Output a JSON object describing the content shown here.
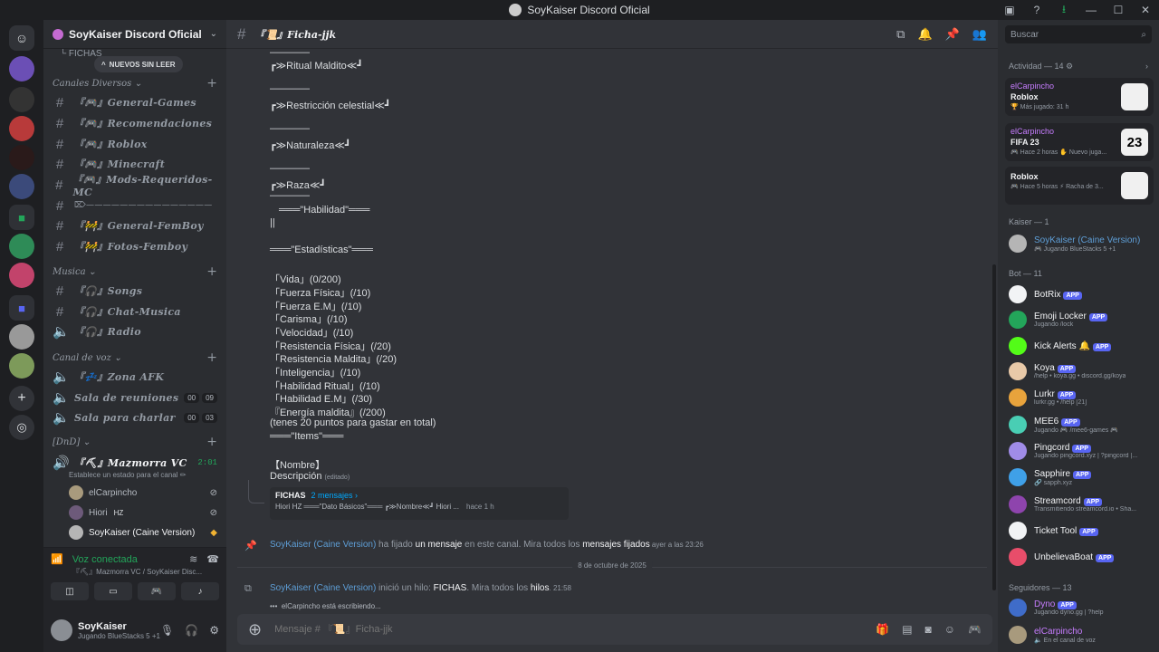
{
  "window": {
    "title": "SoyKaiser Discord Oficial"
  },
  "guild": {
    "name": "SoyKaiser Discord Oficial",
    "new_unread": "NUEVOS SIN LEER",
    "fichas_label": "FICHAS"
  },
  "categories": {
    "diversos": "Canales Diversos",
    "musica": "Musica",
    "voz": "Canal de voz",
    "dnd": "[DnD]"
  },
  "channels": [
    "『🎮』General-Games",
    "『🎮』Recomendaciones",
    "『🎮』Roblox",
    "『🎮』Minecraft",
    "『🎮』Mods-Requeridos-MC",
    "⌦———————————————",
    "『🚧』General-FemBoy",
    "『🚧』Fotos-Femboy"
  ],
  "music_channels": [
    "『🎧』Songs",
    "『🎧』Chat-Musica",
    "『🎧』Radio"
  ],
  "voice_channels": [
    {
      "name": "『💤』Zona AFK"
    },
    {
      "name": "Sala de reuniones",
      "c1": "00",
      "c2": "09"
    },
    {
      "name": "Sala para charlar",
      "c1": "00",
      "c2": "03"
    }
  ],
  "dnd_vc": {
    "name": "『⛏』Mazmorra VC",
    "time": "2:01",
    "status": "Establece un estado para el canal ✏"
  },
  "vc_users": [
    {
      "name": "elCarpincho"
    },
    {
      "name": "Hiori",
      "tag": "HZ"
    },
    {
      "name": "SoyKaiser (Caine Version)"
    }
  ],
  "voice_panel": {
    "status": "Voz conectada",
    "sub": "『⛏』Mazmorra VC / SoyKaiser Disc..."
  },
  "user": {
    "name": "SoyKaiser",
    "status": "Jugando BlueStacks 5 +1"
  },
  "channel_header": {
    "title": "『📜』Ficha-jjk"
  },
  "message_lines": [
    "————",
    "┏≫Ritual Maldito≪┛",
    "————",
    "┏≫Restricción celestial≪┛",
    "————",
    "┏≫Naturaleza≪┛",
    "————",
    "┏≫Raza≪┛",
    "————",
    "═══\"Habilidad\"═══",
    "||",
    "═══\"Estadísticas\"═══",
    "「Vida」(0/200)",
    "「Fuerza Física」(/10)",
    "「Fuerza E.M」(/10)",
    "「Carisma」(/10)",
    "「Velocidad」(/10)",
    "「Resistencia Física」(/20)",
    "「Resistencia Maldita」(/20)",
    "「Inteligencia」(/10)",
    "「Habilidad Ritual」(/10)",
    "「Habilidad E.M」(/30)",
    "『Energía maldita』(/200)",
    "(tenes 20 puntos para gastar en total)",
    "═══\"Items\"═══",
    "【Nombre】",
    "Descripción"
  ],
  "edited": "(editado)",
  "thread": {
    "title": "FICHAS",
    "count": "2 mensajes ›",
    "preview": "Hiori  HZ  ═══\"Dato Básicos\"═══  ┏≫Nombre≪┛  Hiori ...",
    "time": "hace 1 h"
  },
  "pin_msg": {
    "who": "SoyKaiser (Caine Version)",
    "t1": " ha fijado ",
    "s1": "un mensaje",
    "t2": " en este canal. Mira todos los ",
    "s2": "mensajes fijados",
    "ts": " ayer a las 23:26"
  },
  "date_divider": "8 de octubre de 2025",
  "thread_msg": {
    "who": "SoyKaiser (Caine Version)",
    "t1": " inició un hilo: ",
    "s1": "FICHAS",
    "t2": ". Mira todos los ",
    "s2": "hilos",
    "ts": ". 21:58"
  },
  "typing": "elCarpincho está escribiendo...",
  "composer": {
    "placeholder": "Mensaje # 『📜』Ficha-jjk"
  },
  "members": {
    "search": "Buscar",
    "activity_header": "Actividad — 14 ⚙",
    "activities": [
      {
        "name": "elCarpincho",
        "game": "Roblox",
        "time": "🏆 Más jugado: 31 h",
        "img": ""
      },
      {
        "name": "elCarpincho",
        "game": "FIFA 23",
        "time": "🎮 Hace 2 horas  ✋ Nuevo juga...",
        "img": "23"
      },
      {
        "name": "",
        "game": "Roblox",
        "time": "🎮 Hace 5 horas  ⚡ Racha de 3...",
        "img": ""
      }
    ],
    "kaiser_header": "Kaiser — 1",
    "kaiser": {
      "name": "SoyKaiser (Caine Version)",
      "status": "🎮 Jugando BlueStacks 5 +1"
    },
    "bot_header": "Bot — 11",
    "bots": [
      {
        "name": "BotRix",
        "status": ""
      },
      {
        "name": "Emoji Locker",
        "status": "Jugando /lock"
      },
      {
        "name": "Kick Alerts 🔔",
        "status": ""
      },
      {
        "name": "Koya",
        "status": "/help • koya.gg • discord.gg/koya"
      },
      {
        "name": "Lurkr",
        "status": "lurkr.gg • /help [21]"
      },
      {
        "name": "MEE6",
        "status": "Jugando 🎮 /mee6-games 🎮"
      },
      {
        "name": "Pingcord",
        "status": "Jugando pingcord.xyz | ?pingcord |..."
      },
      {
        "name": "Sapphire",
        "status": "🔗 sapph.xyz"
      },
      {
        "name": "Streamcord",
        "status": "Transmitiendo streamcord.io • Sha..."
      },
      {
        "name": "Ticket Tool",
        "status": ""
      },
      {
        "name": "UnbelievaBoat",
        "status": ""
      }
    ],
    "app_label": "APP",
    "follower_header": "Seguidores — 13",
    "followers": [
      {
        "name": "Dyno",
        "status": "Jugando dyno.gg | ?help"
      },
      {
        "name": "elCarpincho",
        "status": "🔈 En el canal de voz"
      }
    ]
  }
}
